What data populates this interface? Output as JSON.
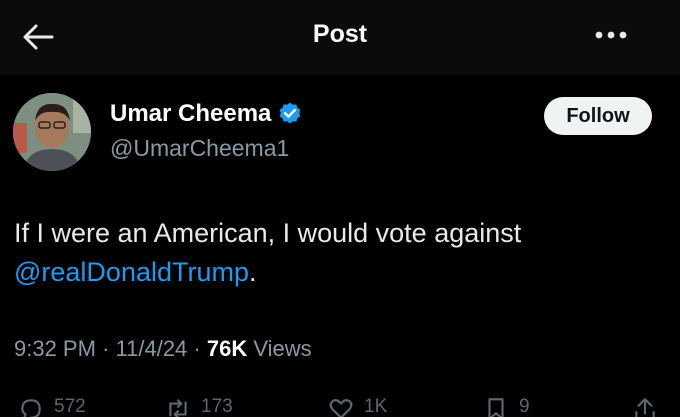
{
  "header": {
    "back_icon": "arrow-left-icon",
    "title": "Post",
    "more_icon": "ellipsis-icon"
  },
  "author": {
    "name": "Umar Cheema",
    "handle": "@UmarCheema1",
    "verified_icon": "verified-badge-icon",
    "verified_color": "#1d9bf0",
    "follow_label": "Follow"
  },
  "tweet": {
    "text": "If I were an American, I would vote against",
    "mention": "@realDonaldTrump",
    "trailing": "."
  },
  "meta": {
    "time": "9:32 PM",
    "date": "11/4/24",
    "views_count": "76K",
    "views_label": "Views"
  },
  "actions": {
    "replies": "572",
    "reposts": "173",
    "likes": "1K",
    "bookmarks": "9"
  },
  "colors": {
    "background": "#000000",
    "accent": "#1d9bf0",
    "secondary_text": "#8b98a5"
  }
}
